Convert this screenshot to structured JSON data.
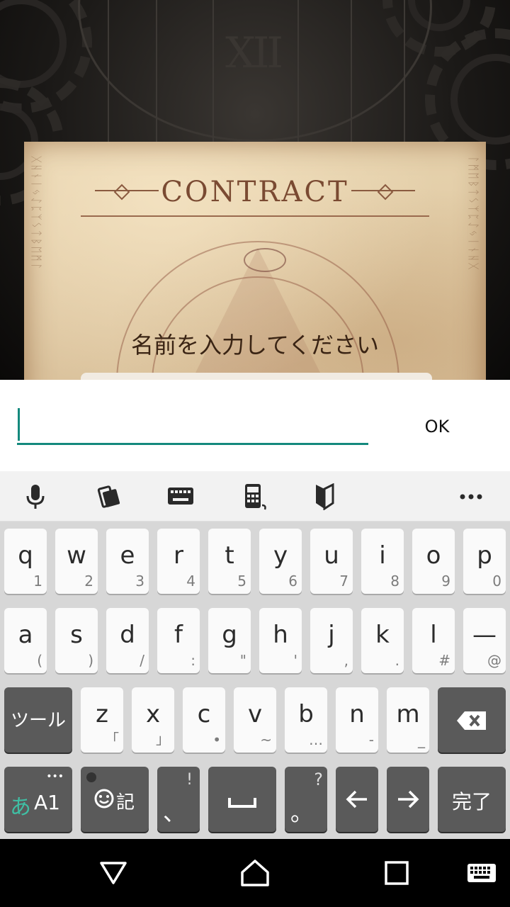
{
  "game": {
    "contract_title": "CONTRACT",
    "clock_numeral": "XII",
    "prompt": "名前を入力してください"
  },
  "input": {
    "value": "",
    "placeholder": "",
    "ok_label": "OK",
    "accent_color": "#14897d"
  },
  "toolbar": {
    "icons": [
      "microphone-icon",
      "phone-rotate-icon",
      "keyboard-icon",
      "calculator-icon",
      "beginner-mark-icon",
      "more-icon"
    ]
  },
  "keyboard": {
    "row1": [
      {
        "key": "q",
        "sub": "1"
      },
      {
        "key": "w",
        "sub": "2"
      },
      {
        "key": "e",
        "sub": "3"
      },
      {
        "key": "r",
        "sub": "4"
      },
      {
        "key": "t",
        "sub": "5"
      },
      {
        "key": "y",
        "sub": "6"
      },
      {
        "key": "u",
        "sub": "7"
      },
      {
        "key": "i",
        "sub": "8"
      },
      {
        "key": "o",
        "sub": "9"
      },
      {
        "key": "p",
        "sub": "0"
      }
    ],
    "row2": [
      {
        "key": "a",
        "sub": "("
      },
      {
        "key": "s",
        "sub": ")"
      },
      {
        "key": "d",
        "sub": "/"
      },
      {
        "key": "f",
        "sub": ":"
      },
      {
        "key": "g",
        "sub": "\""
      },
      {
        "key": "h",
        "sub": "'"
      },
      {
        "key": "j",
        "sub": ","
      },
      {
        "key": "k",
        "sub": "."
      },
      {
        "key": "l",
        "sub": "#"
      },
      {
        "key": "—",
        "sub": "@"
      }
    ],
    "row3_tool": "ツール",
    "row3": [
      {
        "key": "z",
        "sub": "「"
      },
      {
        "key": "x",
        "sub": "」"
      },
      {
        "key": "c",
        "sub": "•"
      },
      {
        "key": "v",
        "sub": "~"
      },
      {
        "key": "b",
        "sub": "…"
      },
      {
        "key": "n",
        "sub": "-"
      },
      {
        "key": "m",
        "sub": "_"
      }
    ],
    "mode_kana": "あ",
    "mode_alpha": "A1",
    "mode_dots": "•••",
    "emoji_label": "記",
    "comma": "、",
    "comma_sub": "!",
    "period": "。",
    "period_sub": "?",
    "done": "完了"
  }
}
